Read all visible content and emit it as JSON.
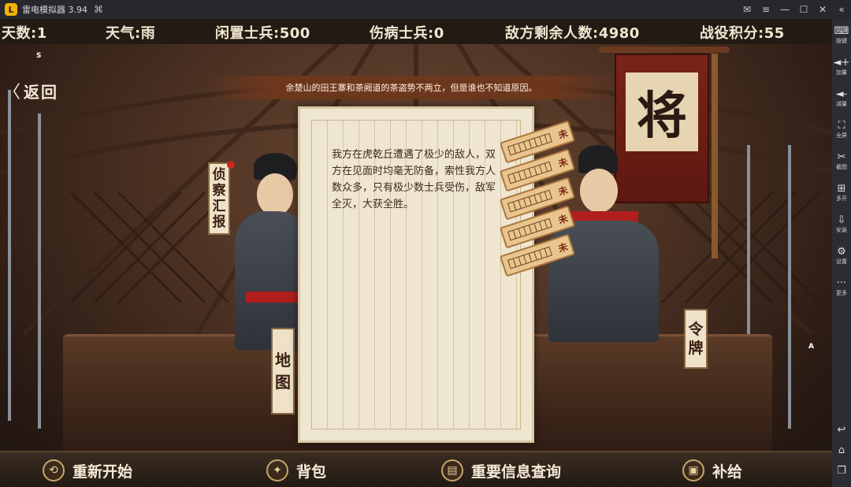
{
  "emulator": {
    "title": "雷电模拟器 3.94",
    "logo_glyph": "L",
    "controls": [
      {
        "name": "mail-icon",
        "glyph": "✉"
      },
      {
        "name": "menu-icon",
        "glyph": "≡"
      },
      {
        "name": "minimize-icon",
        "glyph": "—"
      },
      {
        "name": "maximize-icon",
        "glyph": "☐"
      },
      {
        "name": "close-icon",
        "glyph": "✕"
      },
      {
        "name": "collapse-sidebar-icon",
        "glyph": "«"
      }
    ],
    "sidebar": [
      {
        "name": "keymap",
        "glyph": "⌨",
        "label": "按键"
      },
      {
        "name": "volume-up",
        "glyph": "◄+",
        "label": "加量"
      },
      {
        "name": "volume-down",
        "glyph": "◄-",
        "label": "减量"
      },
      {
        "name": "fullscreen",
        "glyph": "⛶",
        "label": "全屏"
      },
      {
        "name": "screenshot",
        "glyph": "✂",
        "label": "截图"
      },
      {
        "name": "multi-instance",
        "glyph": "⊞",
        "label": "多开"
      },
      {
        "name": "install-apk",
        "glyph": "⇩",
        "label": "安装"
      },
      {
        "name": "settings",
        "glyph": "⚙",
        "label": "设置"
      },
      {
        "name": "more",
        "glyph": "···",
        "label": "更多"
      }
    ],
    "nav": [
      {
        "name": "back-nav-icon",
        "glyph": "↩"
      },
      {
        "name": "home-nav-icon",
        "glyph": "⌂"
      },
      {
        "name": "recents-nav-icon",
        "glyph": "❐"
      }
    ]
  },
  "stats": {
    "days": "天数:1",
    "weather": "天气:雨",
    "idle_soldiers": "闲置士兵:500",
    "wounded_soldiers": "伤病士兵:0",
    "enemy_remaining": "敌方剩余人数:4980",
    "battle_points": "战役积分:55"
  },
  "markers": {
    "s": "S",
    "a": "A"
  },
  "back": {
    "icon": "〈",
    "label": "返回"
  },
  "notice": "余楚山的田王寨和茶阙道的茶盗势不两立，但是谁也不知道原因。",
  "flag_char": "将",
  "side_tags": {
    "scout_report": [
      "侦",
      "察",
      "汇",
      "报"
    ],
    "map": [
      "地",
      "图"
    ],
    "token": [
      "令",
      "牌"
    ]
  },
  "scroll": {
    "text": "我方在虎乾丘遭遇了极少的敌人，双方在见面时均毫无防备，索性我方人数众多，只有极少数士兵受伤，敌军全灭，大获全胜。"
  },
  "slips": [
    "未",
    "未",
    "未",
    "未",
    "未"
  ],
  "bottom": [
    {
      "name": "restart",
      "icon": "⟲",
      "label": "重新开始"
    },
    {
      "name": "backpack",
      "icon": "✦",
      "label": "背包"
    },
    {
      "name": "info-query",
      "icon": "▤",
      "label": "重要信息查询"
    },
    {
      "name": "supply",
      "icon": "▣",
      "label": "补给"
    }
  ]
}
